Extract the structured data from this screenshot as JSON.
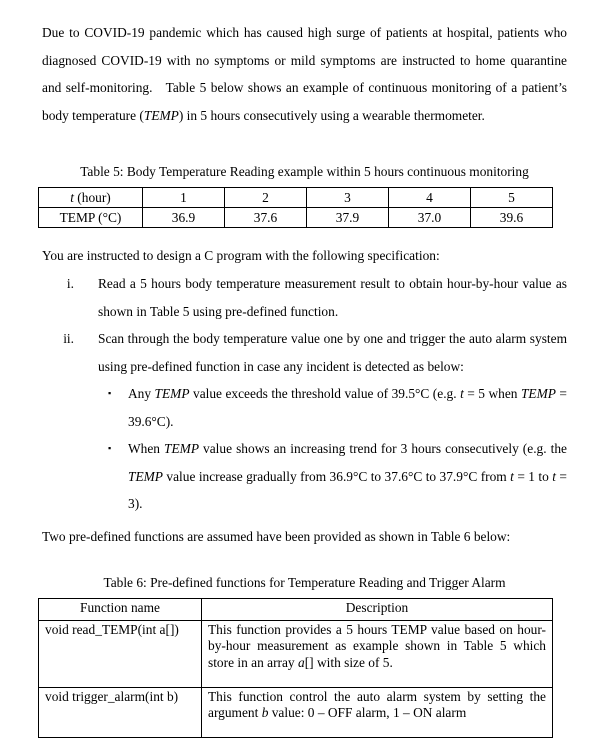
{
  "document": {
    "intro_paragraph": "Due to COVID-19 pandemic which has caused high surge of patients at hospital, patients who diagnosed COVID-19 with no symptoms or mild symptoms are instructed to home quarantine and self-monitoring.   Table 5 below shows an example of continuous monitoring of a patient's body temperature (TEMP) in 5 hours consecutively using a wearable thermometer.",
    "spec_intro": "You are instructed to design a C program with the following specification:",
    "two_functions_intro": "Two pre-defined functions are assumed have been provided as shown in Table 6 below:"
  },
  "table5": {
    "caption": "Table 5: Body Temperature Reading example within 5 hours continuous monitoring",
    "row_labels": [
      "t (hour)",
      "TEMP (°C)"
    ],
    "hours": [
      "1",
      "2",
      "3",
      "4",
      "5"
    ],
    "temps": [
      "36.9",
      "37.6",
      "37.9",
      "37.0",
      "39.6"
    ]
  },
  "spec_list": [
    {
      "marker": "i.",
      "text": "Read a 5 hours body temperature measurement result to obtain hour-by-hour value as shown in Table 5 using pre-defined function."
    },
    {
      "marker": "ii.",
      "text": "Scan through the body temperature value one by one and trigger the auto alarm system using pre-defined function in case any incident is detected as below:"
    }
  ],
  "bullets": [
    {
      "marker": "▪",
      "text": "Any TEMP value exceeds the threshold value of 39.5°C (e.g. t = 5 when TEMP = 39.6°C)."
    },
    {
      "marker": "▪",
      "text": "When TEMP value shows an increasing trend for 3 hours consecutively (e.g. the TEMP value increase gradually from 36.9°C to 37.6°C to 37.9°C from t = 1 to t = 3)."
    }
  ],
  "table6": {
    "caption": "Table 6: Pre-defined functions for Temperature Reading and Trigger Alarm",
    "headers": [
      "Function name",
      "Description"
    ],
    "rows": [
      {
        "function_name": "void read_TEMP(int a[])",
        "description": "This function provides a 5 hours TEMP value based on hour-by-hour measurement as example shown in Table 5 which store in an array a[] with size of 5."
      },
      {
        "function_name": "void trigger_alarm(int b)",
        "description": "This function control the auto alarm system by setting the argument b value: 0 – OFF alarm, 1 – ON alarm"
      }
    ]
  }
}
